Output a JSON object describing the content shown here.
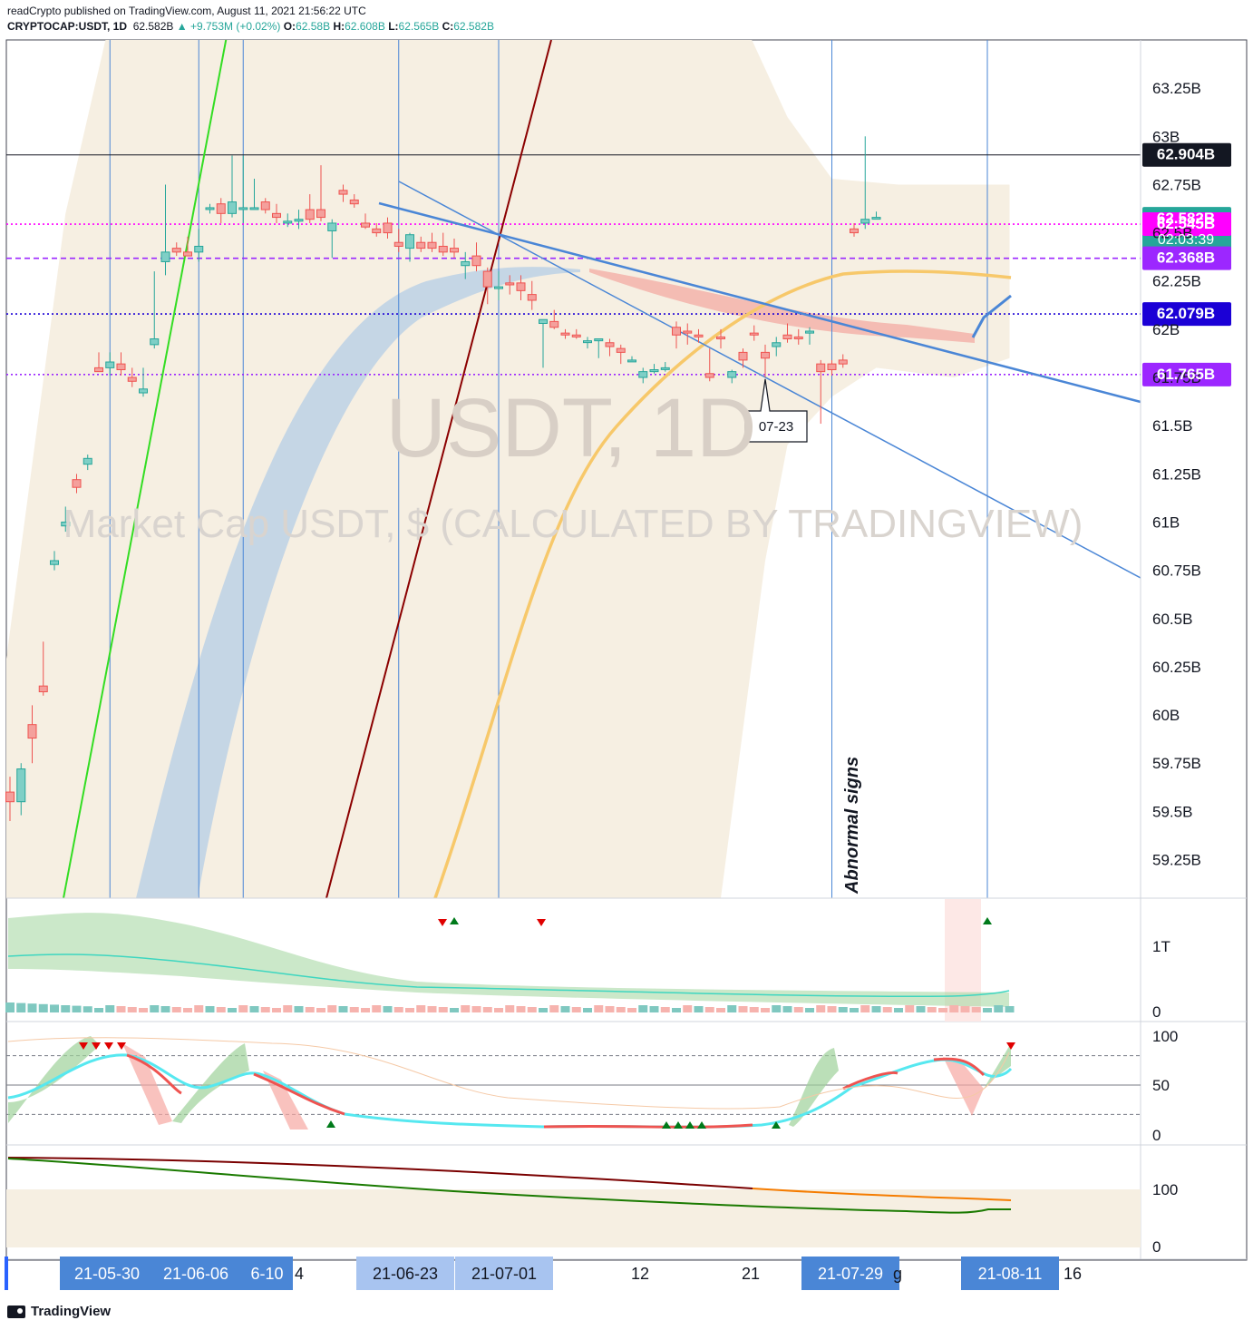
{
  "header": {
    "publisher_line": "readCrypto published on TradingView.com, August 11, 2021 21:56:22 UTC",
    "symbol": "CRYPTOCAP:USDT, 1D",
    "last": "62.582B",
    "change": "▲ +9.753M (+0.02%)",
    "o_label": "O:",
    "o": "62.58B",
    "h_label": "H:",
    "h": "62.608B",
    "l_label": "L:",
    "l": "62.565B",
    "c_label": "C:",
    "c": "62.582B"
  },
  "footer": {
    "brand": "TradingView"
  },
  "colors": {
    "up": "#26a69a",
    "down": "#ef5350",
    "trend_blue": "#4a86d6",
    "green_line": "#33dd22",
    "darkred_line": "#8b0000",
    "yellow_ma": "#f7c86a",
    "band_fill": "#f6efe2",
    "magenta": "#ff00ff",
    "purple": "#9c27ff",
    "navy": "#1b00d6",
    "teal_label": "#26a69a"
  },
  "chart_data": {
    "type": "candlestick",
    "title": "USDT, 1D",
    "watermark_symbol": "USDT, 1D",
    "watermark_description": "Market Cap USDT, $ (CALCULATED BY TRADINGVIEW)",
    "y_unit": "B",
    "ylim": [
      59.05,
      63.5
    ],
    "y_ticks": [
      "63.25B",
      "63B",
      "62.75B",
      "62.5B",
      "62.25B",
      "62B",
      "61.75B",
      "61.5B",
      "61.25B",
      "61B",
      "60.75B",
      "60.5B",
      "60.25B",
      "60B",
      "59.75B",
      "59.5B",
      "59.25B"
    ],
    "y_tick_values": [
      63.25,
      63.0,
      62.75,
      62.5,
      62.25,
      62.0,
      61.75,
      61.5,
      61.25,
      61.0,
      60.75,
      60.5,
      60.25,
      60.0,
      59.75,
      59.5,
      59.25
    ],
    "candles": [
      [
        59.6,
        59.68,
        59.45,
        59.55
      ],
      [
        59.55,
        59.75,
        59.48,
        59.72
      ],
      [
        59.95,
        60.05,
        59.75,
        59.88
      ],
      [
        60.15,
        60.38,
        60.1,
        60.12
      ],
      [
        60.78,
        60.85,
        60.75,
        60.8
      ],
      [
        60.98,
        61.08,
        60.95,
        61.0
      ],
      [
        61.22,
        61.25,
        61.15,
        61.18
      ],
      [
        61.3,
        61.35,
        61.27,
        61.33
      ],
      [
        61.8,
        61.88,
        61.78,
        61.78
      ],
      [
        61.8,
        61.88,
        61.76,
        61.83
      ],
      [
        61.82,
        61.88,
        61.76,
        61.79
      ],
      [
        61.75,
        61.8,
        61.7,
        61.73
      ],
      [
        61.67,
        61.8,
        61.65,
        61.69
      ],
      [
        61.92,
        62.3,
        61.9,
        61.95
      ],
      [
        62.35,
        62.75,
        62.28,
        62.4
      ],
      [
        62.42,
        62.45,
        62.38,
        62.4
      ],
      [
        62.4,
        62.48,
        62.4,
        62.38
      ],
      [
        62.4,
        62.52,
        62.35,
        62.43
      ],
      [
        62.63,
        62.65,
        62.6,
        62.63
      ],
      [
        62.65,
        62.68,
        62.55,
        62.6
      ],
      [
        62.6,
        62.9,
        62.58,
        62.66
      ],
      [
        62.63,
        62.9,
        62.55,
        62.63
      ],
      [
        62.63,
        62.78,
        62.62,
        62.63
      ],
      [
        62.66,
        62.68,
        62.6,
        62.62
      ],
      [
        62.6,
        62.65,
        62.55,
        62.58
      ],
      [
        62.55,
        62.6,
        62.53,
        62.56
      ],
      [
        62.56,
        62.62,
        62.52,
        62.57
      ],
      [
        62.62,
        62.7,
        62.55,
        62.57
      ],
      [
        62.62,
        62.85,
        62.56,
        62.58
      ],
      [
        62.51,
        62.57,
        62.37,
        62.55
      ],
      [
        62.72,
        62.75,
        62.66,
        62.7
      ],
      [
        62.67,
        62.7,
        62.63,
        62.65
      ],
      [
        62.55,
        62.6,
        62.52,
        62.53
      ],
      [
        62.52,
        62.55,
        62.48,
        62.5
      ],
      [
        62.55,
        62.58,
        62.47,
        62.5
      ],
      [
        62.45,
        62.52,
        62.4,
        62.43
      ],
      [
        62.42,
        62.5,
        62.35,
        62.49
      ],
      [
        62.45,
        62.48,
        62.4,
        62.42
      ],
      [
        62.45,
        62.5,
        62.4,
        62.42
      ],
      [
        62.43,
        62.5,
        62.38,
        62.4
      ],
      [
        62.42,
        62.47,
        62.37,
        62.4
      ],
      [
        62.33,
        62.4,
        62.26,
        62.35
      ],
      [
        62.38,
        62.45,
        62.3,
        62.33
      ],
      [
        62.3,
        62.32,
        62.13,
        62.22
      ],
      [
        62.22,
        62.3,
        62.15,
        62.22
      ],
      [
        62.24,
        62.28,
        62.18,
        62.23
      ],
      [
        62.24,
        62.28,
        62.15,
        62.2
      ],
      [
        62.18,
        62.25,
        62.1,
        62.15
      ],
      [
        62.03,
        62.05,
        61.8,
        62.05
      ],
      [
        62.04,
        62.1,
        62.0,
        62.01
      ],
      [
        61.98,
        62.0,
        61.95,
        61.97
      ],
      [
        61.97,
        62.0,
        61.95,
        61.96
      ],
      [
        61.94,
        61.96,
        61.9,
        61.94
      ],
      [
        61.94,
        61.95,
        61.85,
        61.95
      ],
      [
        61.93,
        61.95,
        61.86,
        61.91
      ],
      [
        61.9,
        61.92,
        61.82,
        61.88
      ],
      [
        61.84,
        61.86,
        61.83,
        61.84
      ],
      [
        61.75,
        61.8,
        61.72,
        61.78
      ],
      [
        61.78,
        61.82,
        61.77,
        61.79
      ],
      [
        61.8,
        61.83,
        61.78,
        61.8
      ],
      [
        62.01,
        62.04,
        61.9,
        61.97
      ],
      [
        61.99,
        62.03,
        61.92,
        61.98
      ],
      [
        61.97,
        62.0,
        61.93,
        61.96
      ],
      [
        61.77,
        61.9,
        61.73,
        61.75
      ],
      [
        61.96,
        62.0,
        61.9,
        61.95
      ],
      [
        61.75,
        61.79,
        61.72,
        61.78
      ],
      [
        61.88,
        61.9,
        61.8,
        61.84
      ],
      [
        61.98,
        62.02,
        61.94,
        61.97
      ],
      [
        61.88,
        61.92,
        61.75,
        61.85
      ],
      [
        61.91,
        61.96,
        61.86,
        61.93
      ],
      [
        61.97,
        62.03,
        61.93,
        61.95
      ],
      [
        61.96,
        62.0,
        61.92,
        61.95
      ],
      [
        61.98,
        62.01,
        61.92,
        61.99
      ],
      [
        61.82,
        61.84,
        61.51,
        61.78
      ],
      [
        61.82,
        61.84,
        61.76,
        61.79
      ],
      [
        61.84,
        61.87,
        61.8,
        61.82
      ],
      [
        62.52,
        62.55,
        62.48,
        62.5
      ],
      [
        62.55,
        63.0,
        62.52,
        62.57
      ],
      [
        62.58,
        62.61,
        62.57,
        62.58
      ]
    ],
    "price_labels": [
      {
        "value": 62.904,
        "text": "62.904B",
        "color": "#131722"
      },
      {
        "value": 62.582,
        "text": "62.582B",
        "sub": "02:03:39",
        "color": "#26a69a"
      },
      {
        "value": 62.545,
        "text": "62.545B",
        "color": "#ff00ff"
      },
      {
        "value": 62.368,
        "text": "62.368B",
        "color": "#9c27ff"
      },
      {
        "value": 62.079,
        "text": "62.079B",
        "color": "#1b00d6"
      },
      {
        "value": 61.765,
        "text": "61.765B",
        "color": "#9c27ff"
      }
    ],
    "hlines": [
      {
        "value": 62.904,
        "color": "#131722",
        "style": "solid"
      },
      {
        "value": 62.545,
        "color": "#ff00ff",
        "style": "dotted"
      },
      {
        "value": 62.368,
        "color": "#9c27ff",
        "style": "dashed"
      },
      {
        "value": 62.079,
        "color": "#1b00d6",
        "style": "dotted"
      },
      {
        "value": 61.765,
        "color": "#9c27ff",
        "style": "dotted"
      }
    ],
    "vertical_line_bars": [
      9,
      17,
      21,
      35,
      44,
      74,
      88
    ],
    "callout": {
      "text": "07-23",
      "bar": 68
    },
    "annotation_text": "Abnormal signs",
    "x_axis_labels": [
      {
        "text": "21-05-30",
        "bar": 9,
        "highlight": "strong"
      },
      {
        "text": "21-06-06",
        "bar": 16,
        "highlight": "strong"
      },
      {
        "text": "6-10",
        "bar": 21,
        "highlight": "strong"
      },
      {
        "text": "4",
        "bar": 25,
        "highlight": "none"
      },
      {
        "text": "21-06-23",
        "bar": 35,
        "highlight": "light"
      },
      {
        "text": "21-07-01",
        "bar": 43,
        "highlight": "light"
      },
      {
        "text": "12",
        "bar": 55,
        "highlight": "none"
      },
      {
        "text": "21",
        "bar": 65,
        "highlight": "none"
      },
      {
        "text": "21-07-29",
        "bar": 74,
        "highlight": "strong"
      },
      {
        "text": "g",
        "bar": 78,
        "highlight": "none"
      },
      {
        "text": "21-08-11",
        "bar": 88,
        "highlight": "strong"
      },
      {
        "text": "16",
        "bar": 93,
        "highlight": "none"
      }
    ],
    "volume_panel": {
      "y_ticks": [
        "1T",
        "0"
      ]
    },
    "stoch_panel": {
      "y_ticks": [
        "100",
        "50",
        "0"
      ]
    },
    "bottom_panel": {
      "y_ticks": [
        "100",
        "0"
      ]
    }
  }
}
